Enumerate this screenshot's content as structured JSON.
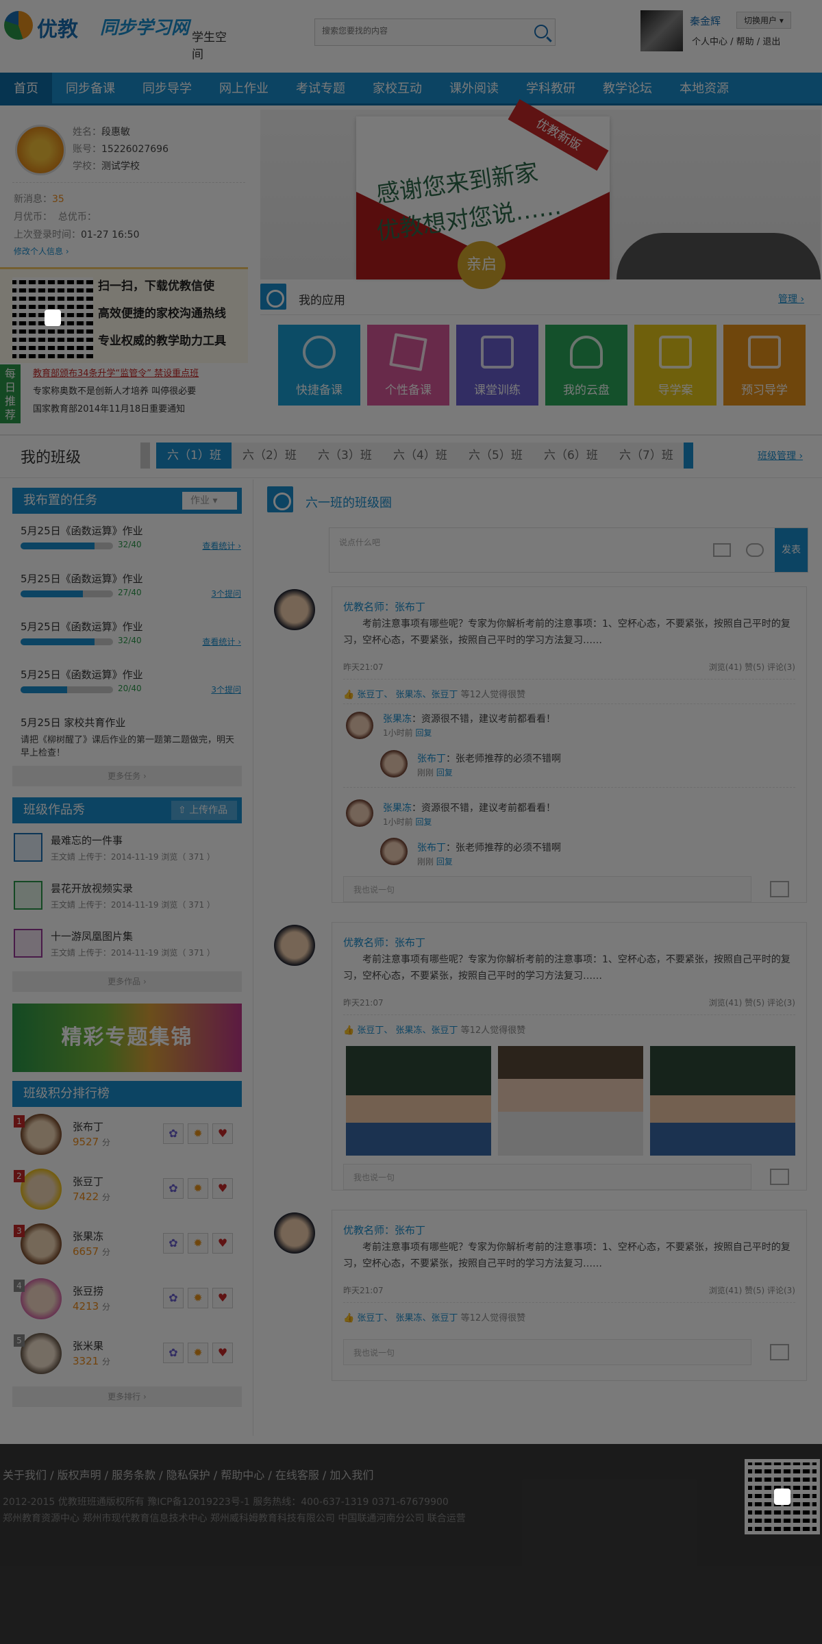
{
  "header": {
    "logo_text": "优教",
    "logo_brand": "同步学习网",
    "logo_sub": "学生空间",
    "search_placeholder": "搜索您要找的内容",
    "user_name": "秦金辉",
    "switch_user": "切换用户",
    "links": [
      "个人中心",
      "帮助",
      "退出"
    ]
  },
  "nav": [
    "首页",
    "同步备课",
    "同步导学",
    "网上作业",
    "考试专题",
    "家校互动",
    "课外阅读",
    "学科教研",
    "教学论坛",
    "本地资源"
  ],
  "profile": {
    "name_label": "姓名：",
    "name": "段惠敏",
    "account_label": "账号：",
    "account": "15226027696",
    "school_label": "学校：",
    "school": "测试学校",
    "new_msg_label": "新消息：",
    "new_msg": "35",
    "coins_label": "月优币：",
    "total_label": "总优币：",
    "last_login_label": "上次登录时间：",
    "last_login": "01-27 16:50",
    "edit": "修改个人信息"
  },
  "qr_promo": [
    "扫一扫，下载优教信使",
    "高效便捷的家校沟通热线",
    "专业权威的教学助力工具"
  ],
  "daily": {
    "tag": "每日推荐",
    "items": [
      "教育部颁布34条升学“监管令” 禁设重点班",
      "专家称奥数不是创新人才培养 叫停很必要",
      "国家教育部2014年11月18日重要通知"
    ]
  },
  "banner": {
    "line1": "感谢您来到新家",
    "line2": "优教想对您说……",
    "ribbon": "优教新版",
    "seal": "亲启"
  },
  "apps": {
    "title": "我的应用",
    "manage": "管理",
    "tiles": [
      {
        "label": "快捷备课",
        "color": "#1a9fd6",
        "icon": "clock-icon"
      },
      {
        "label": "个性备课",
        "color": "#d9589b",
        "icon": "star-icon"
      },
      {
        "label": "课堂训练",
        "color": "#6a5fcf",
        "icon": "edit-icon"
      },
      {
        "label": "我的云盘",
        "color": "#2aa85a",
        "icon": "cloud-icon"
      },
      {
        "label": "导学案",
        "color": "#e8c81a",
        "icon": "document-icon"
      },
      {
        "label": "预习导学",
        "color": "#e8921a",
        "icon": "checkbox-icon"
      }
    ]
  },
  "class": {
    "title": "我的班级",
    "tabs": [
      "六（1）班",
      "六（2）班",
      "六（3）班",
      "六（4）班",
      "六（5）班",
      "六（6）班",
      "六（7）班"
    ],
    "manage": "班级管理"
  },
  "tasks": {
    "title": "我布置的任务",
    "filter": "作业",
    "items": [
      {
        "title": "5月25日《函数运算》作业",
        "count": "32/40",
        "progress": 0.8,
        "link": "查看统计"
      },
      {
        "title": "5月25日《函数运算》作业",
        "count": "27/40",
        "progress": 0.675,
        "link": "3个提问"
      },
      {
        "title": "5月25日《函数运算》作业",
        "count": "32/40",
        "progress": 0.8,
        "link": "查看统计"
      },
      {
        "title": "5月25日《函数运算》作业",
        "count": "20/40",
        "progress": 0.5,
        "link": "3个提问"
      }
    ],
    "shared_title": "5月25日 家校共育作业",
    "shared_body": "请把《柳树醒了》课后作业的第一题第二题做完，明天早上检查！",
    "more": "更多任务"
  },
  "works": {
    "title": "班级作品秀",
    "upload": "上传作品",
    "items": [
      {
        "title": "最难忘的一件事",
        "meta": "王文婧 上传于：2014-11-19   浏览（ 371 ）",
        "color": "#1a6fb3",
        "icon": "word-doc-icon"
      },
      {
        "title": "昙花开放视频实录",
        "meta": "王文婧 上传于：2014-11-19   浏览（ 371 ）",
        "color": "#2a9a4a",
        "icon": "video-icon"
      },
      {
        "title": "十一游凤凰图片集",
        "meta": "王文婧 上传于：2014-11-19   浏览（ 371 ）",
        "color": "#9a3a9a",
        "icon": "image-icon"
      }
    ],
    "more": "更多作品"
  },
  "special_banner": "精彩专题集锦",
  "ranking": {
    "title": "班级积分排行榜",
    "unit": "分",
    "items": [
      {
        "rank": "1",
        "name": "张布丁",
        "score": "9527"
      },
      {
        "rank": "2",
        "name": "张豆丁",
        "score": "7422"
      },
      {
        "rank": "3",
        "name": "张果冻",
        "score": "6657"
      },
      {
        "rank": "4",
        "name": "张豆捞",
        "score": "4213"
      },
      {
        "rank": "5",
        "name": "张米果",
        "score": "3321"
      }
    ],
    "more": "更多排行"
  },
  "circle": {
    "title": "六一班的班级圈",
    "post_placeholder": "说点什么吧",
    "post_button": "发表",
    "reply_placeholder": "我也说一句",
    "posts": [
      {
        "author": "优教名师：张布丁",
        "body": "考前注意事项有哪些呢？专家为你解析考前的注意事项：1、空杯心态，不要紧张，按照自己平时的复习，空杯心态，不要紧张，按照自己平时的学习方法复习……",
        "time": "昨天21:07",
        "stats": "浏览(41)    赞(5)    评论(3)",
        "likes": "张豆丁、 张果冻、张豆丁",
        "likes_suffix": "等12人觉得很赞",
        "comments": [
          {
            "name": "张果冻",
            "text": "：资源很不错，建议考前都看看！",
            "time": "1小时前",
            "reply": "回复"
          },
          {
            "name": "张布丁",
            "text": "：张老师推荐的必须不错啊",
            "time": "刚刚",
            "reply": "回复"
          },
          {
            "name": "张果冻",
            "text": "：资源很不错，建议考前都看看！",
            "time": "1小时前",
            "reply": "回复"
          },
          {
            "name": "张布丁",
            "text": "：张老师推荐的必须不错啊",
            "time": "刚刚",
            "reply": "回复"
          }
        ]
      },
      {
        "author": "优教名师：张布丁",
        "body": "考前注意事项有哪些呢？专家为你解析考前的注意事项：1、空杯心态，不要紧张，按照自己平时的复习，空杯心态，不要紧张，按照自己平时的学习方法复习……",
        "time": "昨天21:07",
        "stats": "浏览(41)    赞(5)    评论(3)",
        "likes": "张豆丁、 张果冻、张豆丁",
        "likes_suffix": "等12人觉得很赞"
      },
      {
        "author": "优教名师：张布丁",
        "body": "考前注意事项有哪些呢？专家为你解析考前的注意事项：1、空杯心态，不要紧张，按照自己平时的复习，空杯心态，不要紧张，按照自己平时的学习方法复习……",
        "time": "昨天21:07",
        "stats": "浏览(41)    赞(5)    评论(3)",
        "likes": "张豆丁、 张果冻、张豆丁",
        "likes_suffix": "等12人觉得很赞"
      }
    ]
  },
  "footer": {
    "links": "关于我们   /   版权声明   /   服务条款   /   隐私保护   /   帮助中心   /   在线客服   /   加入我们",
    "copyright": "2012-2015 优教班班通版权所有  豫ICP备12019223号-1      服务热线：400-637-1319    0371-67679900",
    "partners": "郑州教育资源中心     郑州市现代教育信息技术中心    郑州威科姆教育科技有限公司 中国联通河南分公司  联合运营"
  }
}
